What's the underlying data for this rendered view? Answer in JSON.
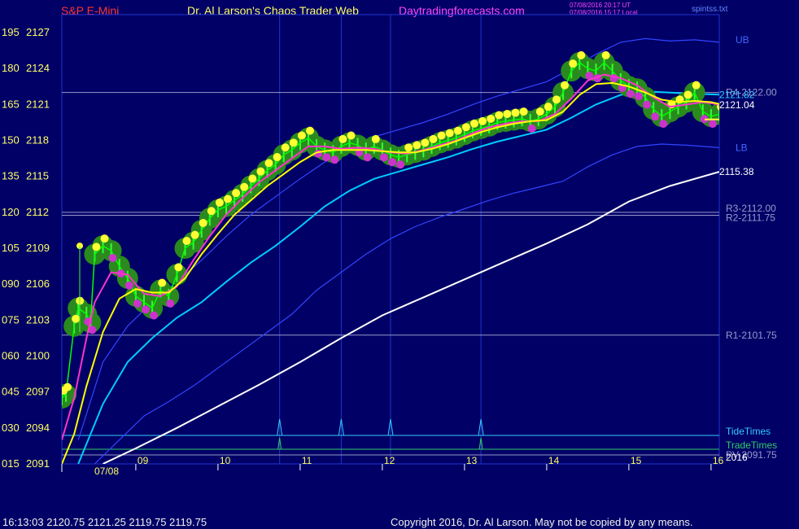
{
  "header": {
    "instrument": "S&P E-Mini",
    "site": "Dr. Al Larson's Chaos Trader Web",
    "domain": "Daytradingforecasts.com",
    "stamp_line1": "07/08/2016 20:17 UT",
    "stamp_line2": "07/08/2016 15:17 Local",
    "file": "spintss.txt"
  },
  "footer": {
    "quote": "16:13:03  2120.75 2121.25 2119.75 2119.75",
    "copyright": "Copyright 2016, Dr. Al Larson. May not be copied by any means."
  },
  "chart_data": {
    "type": "line",
    "title": "S&P E-Mini",
    "y_left_ticks": [
      "195",
      "180",
      "165",
      "150",
      "135",
      "120",
      "105",
      "090",
      "075",
      "060",
      "045",
      "030",
      "015"
    ],
    "y_price_ticks": [
      "2127",
      "2124",
      "2121",
      "2118",
      "2115",
      "2112",
      "2109",
      "2106",
      "2103",
      "2100",
      "2097",
      "2094",
      "2091"
    ],
    "x_ticks": [
      "09",
      "10",
      "11",
      "12",
      "13",
      "14",
      "15",
      "16"
    ],
    "date_label": "07/08",
    "ylim": [
      2091,
      2128.5
    ],
    "xlim": [
      8.1,
      16.1
    ],
    "pivot_levels": [
      {
        "label": "R4-2122.00",
        "value": 2122.0
      },
      {
        "label": "R3-2112.00",
        "value": 2112.0
      },
      {
        "label": "R2-2111.75",
        "value": 2111.75
      },
      {
        "label": "R1-2101.75",
        "value": 2101.75
      },
      {
        "label": "PV-2091.75",
        "value": 2091.75
      }
    ],
    "band_labels": {
      "upper": "UB",
      "lower": "LB"
    },
    "end_values": {
      "fast": "2121.04",
      "mid": "2121.82",
      "slow": "2115.38"
    },
    "tide_label": "TideTimes",
    "trade_label": "TradeTimes",
    "year_label": "2016",
    "tide_times": [
      10.75,
      11.5,
      12.1,
      13.2
    ],
    "trade_times": [
      10.75,
      13.2
    ],
    "vertical_lines": [
      10.75,
      11.5,
      12.1,
      13.2
    ],
    "series": [
      {
        "key": "price",
        "color": "#00ff00",
        "x": [
          8.1,
          8.15,
          8.25,
          8.3,
          8.4,
          8.45,
          8.5,
          8.6,
          8.7,
          8.8,
          8.9,
          9.0,
          9.1,
          9.2,
          9.3,
          9.4,
          9.5,
          9.6,
          9.7,
          9.8,
          9.9,
          10.0,
          10.1,
          10.2,
          10.3,
          10.4,
          10.5,
          10.6,
          10.7,
          10.8,
          10.9,
          11.0,
          11.1,
          11.2,
          11.3,
          11.4,
          11.5,
          11.6,
          11.7,
          11.8,
          11.9,
          12.0,
          12.1,
          12.2,
          12.3,
          12.4,
          12.5,
          12.6,
          12.7,
          12.8,
          12.9,
          13.0,
          13.1,
          13.2,
          13.3,
          13.4,
          13.5,
          13.6,
          13.7,
          13.8,
          13.9,
          14.0,
          14.1,
          14.2,
          14.3,
          14.4,
          14.5,
          14.6,
          14.7,
          14.8,
          14.9,
          15.0,
          15.1,
          15.2,
          15.3,
          15.4,
          15.5,
          15.6,
          15.7,
          15.8,
          15.9,
          16.0,
          16.1
        ],
        "y": [
          2096.5,
          2096.8,
          2102.5,
          2104.0,
          2103.5,
          2102.8,
          2108.5,
          2109.2,
          2108.8,
          2107.5,
          2106.5,
          2105.0,
          2104.5,
          2104.0,
          2105.5,
          2105.0,
          2106.8,
          2109.0,
          2109.5,
          2110.5,
          2111.5,
          2112.2,
          2112.5,
          2113.0,
          2113.5,
          2114.2,
          2114.8,
          2115.5,
          2116.0,
          2116.8,
          2117.2,
          2117.8,
          2118.2,
          2117.5,
          2117.2,
          2117.0,
          2117.5,
          2117.8,
          2117.6,
          2117.2,
          2117.5,
          2117.2,
          2116.8,
          2116.6,
          2116.8,
          2117.0,
          2117.2,
          2117.5,
          2117.8,
          2118.0,
          2118.2,
          2118.5,
          2118.8,
          2119.0,
          2119.2,
          2119.5,
          2119.6,
          2119.7,
          2119.8,
          2119.6,
          2119.8,
          2120.2,
          2120.8,
          2122.0,
          2123.8,
          2124.5,
          2124.0,
          2123.8,
          2124.5,
          2123.8,
          2123.0,
          2122.5,
          2122.3,
          2121.6,
          2120.6,
          2120.0,
          2120.4,
          2120.8,
          2121.2,
          2122.0,
          2120.4,
          2120.0,
          2120.2
        ]
      },
      {
        "key": "ma-fast",
        "color": "#ff33cc",
        "x": [
          8.1,
          8.25,
          8.4,
          8.5,
          8.7,
          8.9,
          9.1,
          9.3,
          9.5,
          9.7,
          9.9,
          10.1,
          10.3,
          10.5,
          10.7,
          10.9,
          11.1,
          11.3,
          11.5,
          11.7,
          11.9,
          12.1,
          12.3,
          12.5,
          12.7,
          12.9,
          13.1,
          13.3,
          13.5,
          13.7,
          13.9,
          14.1,
          14.3,
          14.5,
          14.7,
          14.9,
          15.1,
          15.3,
          15.5,
          15.7,
          15.9,
          16.1
        ],
        "y": [
          2093.0,
          2096.5,
          2101.5,
          2104.5,
          2107.0,
          2106.8,
          2105.2,
          2105.0,
          2105.8,
          2108.0,
          2110.0,
          2111.8,
          2113.2,
          2114.5,
          2115.5,
          2116.5,
          2117.5,
          2117.5,
          2117.3,
          2117.4,
          2117.3,
          2117.0,
          2116.9,
          2117.2,
          2117.6,
          2118.0,
          2118.6,
          2119.1,
          2119.4,
          2119.6,
          2119.6,
          2120.2,
          2121.5,
          2123.0,
          2123.5,
          2123.2,
          2122.6,
          2121.6,
          2120.8,
          2121.0,
          2121.2,
          2121.0
        ]
      },
      {
        "key": "ma-mid",
        "color": "#ffff00",
        "x": [
          8.1,
          8.25,
          8.4,
          8.6,
          8.8,
          9.0,
          9.2,
          9.4,
          9.6,
          9.8,
          10.0,
          10.2,
          10.4,
          10.6,
          10.8,
          11.0,
          11.2,
          11.4,
          11.6,
          11.8,
          12.0,
          12.2,
          12.4,
          12.6,
          12.8,
          13.0,
          13.2,
          13.4,
          13.6,
          13.8,
          14.0,
          14.2,
          14.4,
          14.6,
          14.8,
          15.0,
          15.2,
          15.4,
          15.6,
          15.8,
          16.0,
          16.1
        ],
        "y": [
          2091.0,
          2093.5,
          2097.5,
          2102.0,
          2104.8,
          2105.6,
          2105.3,
          2105.3,
          2106.5,
          2108.5,
          2110.2,
          2111.8,
          2113.0,
          2114.2,
          2115.2,
          2116.2,
          2117.0,
          2117.2,
          2117.2,
          2117.2,
          2117.1,
          2117.0,
          2117.0,
          2117.3,
          2117.7,
          2118.2,
          2118.7,
          2119.1,
          2119.4,
          2119.6,
          2119.7,
          2120.4,
          2121.8,
          2122.7,
          2122.8,
          2122.5,
          2122.0,
          2121.4,
          2121.2,
          2121.3,
          2121.2,
          2121.04
        ]
      },
      {
        "key": "ma-slow",
        "color": "#00ccff",
        "x": [
          8.3,
          8.6,
          8.9,
          9.2,
          9.5,
          9.8,
          10.1,
          10.4,
          10.7,
          11.0,
          11.3,
          11.6,
          11.9,
          12.2,
          12.5,
          12.8,
          13.1,
          13.4,
          13.7,
          14.0,
          14.3,
          14.6,
          14.9,
          15.2,
          15.5,
          15.8,
          16.1
        ],
        "y": [
          2091.0,
          2096.0,
          2099.5,
          2101.5,
          2103.2,
          2104.5,
          2106.2,
          2107.8,
          2109.2,
          2110.8,
          2112.5,
          2113.8,
          2114.8,
          2115.4,
          2116.0,
          2116.6,
          2117.3,
          2117.9,
          2118.4,
          2118.9,
          2119.9,
          2121.0,
          2121.8,
          2122.1,
          2122.0,
          2121.9,
          2121.82
        ]
      },
      {
        "key": "upper-band",
        "color": "#3344ff",
        "x": [
          8.3,
          8.6,
          8.9,
          9.2,
          9.5,
          9.8,
          10.1,
          10.4,
          10.7,
          11.0,
          11.3,
          11.6,
          11.9,
          12.2,
          12.5,
          12.8,
          13.1,
          13.4,
          13.7,
          14.0,
          14.3,
          14.6,
          14.9,
          15.2,
          15.5,
          15.8,
          16.1
        ],
        "y": [
          2093.0,
          2099.5,
          2102.5,
          2104.5,
          2106.2,
          2108.0,
          2110.0,
          2111.8,
          2113.3,
          2114.8,
          2116.2,
          2117.4,
          2118.3,
          2118.9,
          2119.5,
          2120.2,
          2121.0,
          2121.7,
          2122.3,
          2122.9,
          2124.0,
          2125.2,
          2126.2,
          2126.5,
          2126.3,
          2126.4,
          2126.2
        ]
      },
      {
        "key": "lower-band",
        "color": "#3344ff",
        "x": [
          8.5,
          8.8,
          9.1,
          9.4,
          9.7,
          10.0,
          10.3,
          10.6,
          10.9,
          11.2,
          11.5,
          11.8,
          12.1,
          12.4,
          12.7,
          13.0,
          13.3,
          13.6,
          13.9,
          14.2,
          14.5,
          14.8,
          15.1,
          15.4,
          15.7,
          16.1
        ],
        "y": [
          2091.0,
          2093.0,
          2095.0,
          2096.2,
          2097.5,
          2099.0,
          2100.5,
          2102.0,
          2103.5,
          2105.5,
          2107.0,
          2108.5,
          2109.8,
          2110.8,
          2111.6,
          2112.3,
          2113.0,
          2113.6,
          2114.1,
          2114.6,
          2115.8,
          2116.8,
          2117.5,
          2117.7,
          2117.6,
          2117.4
        ]
      },
      {
        "key": "ma-long",
        "color": "#ffffff",
        "x": [
          8.6,
          9.0,
          9.5,
          10.0,
          10.5,
          11.0,
          11.5,
          12.0,
          12.5,
          13.0,
          13.5,
          14.0,
          14.5,
          15.0,
          15.5,
          16.1
        ],
        "y": [
          2091.0,
          2092.3,
          2094.0,
          2095.8,
          2097.6,
          2099.5,
          2101.5,
          2103.4,
          2104.9,
          2106.4,
          2107.9,
          2109.4,
          2111.0,
          2112.9,
          2114.2,
          2115.38
        ]
      }
    ]
  }
}
